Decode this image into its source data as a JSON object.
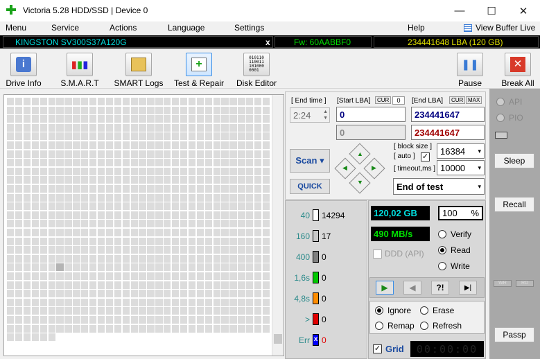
{
  "window": {
    "title": "Victoria 5.28 HDD/SSD | Device 0",
    "minimize_glyph": "—",
    "maximize_glyph": "☐",
    "close_glyph": "✕"
  },
  "menu": {
    "items": [
      "Menu",
      "Service",
      "Actions",
      "Language",
      "Settings",
      "Help"
    ],
    "view_buffer_live": "View Buffer Live"
  },
  "infobar": {
    "model": "KINGSTON SV300S37A120G",
    "close_x": "x",
    "firmware": "Fw: 60AABBF0",
    "capacity": "234441648 LBA (120 GB)"
  },
  "toolbar": {
    "drive_info": "Drive Info",
    "smart": "S.M.A.R.T",
    "smart_logs": "SMART Logs",
    "test_repair": "Test & Repair",
    "disk_editor": "Disk Editor",
    "disk_editor_icon_text": "010110\n110011\n101000\n0001",
    "pause": "Pause",
    "break_all": "Break All"
  },
  "test": {
    "end_time_label": "[ End time ]",
    "end_time_value": "2:24",
    "start_lba_label": "[Start LBA]",
    "cur_label": "CUR",
    "start_cur_value": "0",
    "end_lba_label": "[End LBA]",
    "max_label": "MAX",
    "start_lba_value": "0",
    "end_lba_value": "234441647",
    "start_lba_current": "0",
    "end_lba_current": "234441647",
    "scan_button": "Scan ▾",
    "quick_button": "QUICK",
    "block_size_label": "[ block size ]",
    "auto_label": "[ auto ]",
    "block_size_value": "16384",
    "timeout_label": "[ timeout,ms ]",
    "timeout_value": "10000",
    "end_action": "End of test"
  },
  "latency": [
    {
      "label": "40",
      "color": "#ffffff",
      "count": "14294"
    },
    {
      "label": "160",
      "color": "#c8c8c8",
      "count": "17"
    },
    {
      "label": "400",
      "color": "#808080",
      "count": "0"
    },
    {
      "label": "1,6s",
      "color": "#00c800",
      "count": "0"
    },
    {
      "label": "4,8s",
      "color": "#ff8c00",
      "count": "0"
    },
    {
      "label": ">",
      "color": "#e00000",
      "count": "0"
    },
    {
      "label": "Err",
      "color": "#0000ff",
      "count": "0",
      "mark": "x"
    }
  ],
  "stats": {
    "size": "120,02 GB",
    "percent": "100",
    "percent_sign": "%",
    "speed": "490 MB/s"
  },
  "mode": {
    "ddd_label": "DDD (API)",
    "verify": "Verify",
    "read": "Read",
    "write": "Write"
  },
  "playback": {
    "play": "▶",
    "back": "◀",
    "query": "?!",
    "end": "▶|"
  },
  "action": {
    "ignore": "Ignore",
    "erase": "Erase",
    "remap": "Remap",
    "refresh": "Refresh"
  },
  "grid": {
    "label": "Grid",
    "timer": "00:00:00"
  },
  "side": {
    "api": "API",
    "pio": "PIO",
    "sleep": "Sleep",
    "recall": "Recall",
    "wr": "WR",
    "rd": "RD",
    "passp": "Passp"
  },
  "colors": {
    "accent_cyan": "#00e0e0",
    "accent_green": "#00e000",
    "accent_yellow": "#e0e000",
    "end_lba_red": "#a00000",
    "start_lba_blue": "#000080"
  }
}
